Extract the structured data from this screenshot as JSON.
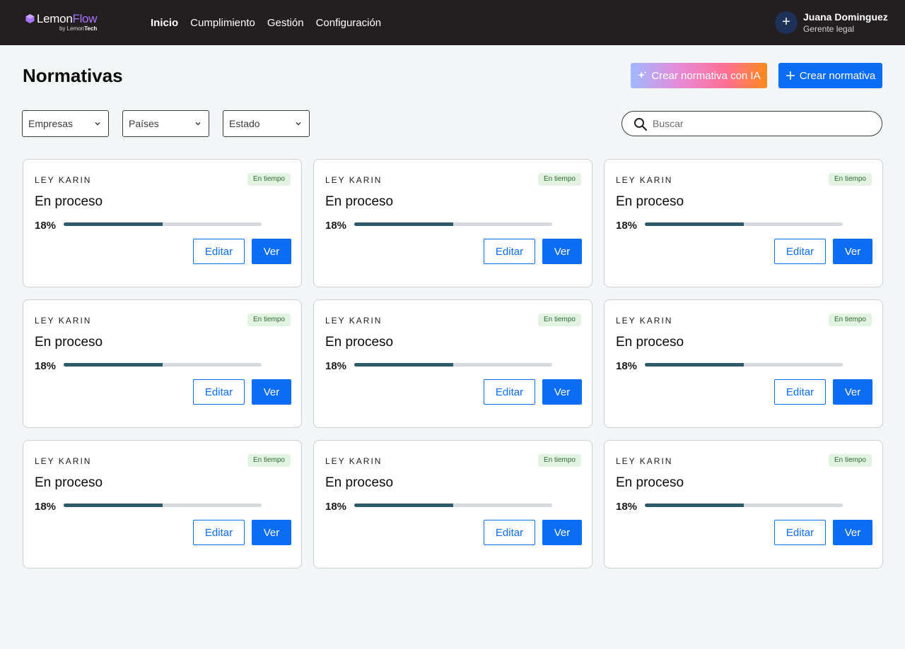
{
  "brand": {
    "name_part1": "Lemon",
    "name_part2": "Flow",
    "sub_prefix": "by ",
    "sub_part1": "Lemon",
    "sub_part2": "Tech"
  },
  "nav": {
    "items": [
      {
        "label": "Inicio",
        "active": true
      },
      {
        "label": "Cumplimiento",
        "active": false
      },
      {
        "label": "Gestión",
        "active": false
      },
      {
        "label": "Configuración",
        "active": false
      }
    ]
  },
  "user": {
    "avatar_glyph": "+",
    "name": "Juana Dominguez",
    "role": "Gerente legal"
  },
  "page": {
    "title": "Normativas"
  },
  "actions": {
    "ai_create_label": "Crear normativa con IA",
    "create_label": "Crear normativa"
  },
  "filters": {
    "companies": "Empresas",
    "countries": "Países",
    "status": "Estado"
  },
  "search": {
    "placeholder": "Buscar",
    "value": ""
  },
  "colors": {
    "primary": "#0b6cf5",
    "topbar": "#231f20",
    "progress": "#2c5a6b",
    "badge_bg": "#e3f3e2",
    "badge_text": "#2f6a35",
    "brand_accent": "#a974ff"
  },
  "cards": [
    {
      "kicker": "LEY KARIN",
      "badge": "En tiempo",
      "status": "En proceso",
      "progress_label": "18%",
      "progress": 0.5,
      "edit_label": "Editar",
      "view_label": "Ver"
    },
    {
      "kicker": "LEY KARIN",
      "badge": "En tiempo",
      "status": "En proceso",
      "progress_label": "18%",
      "progress": 0.5,
      "edit_label": "Editar",
      "view_label": "Ver"
    },
    {
      "kicker": "LEY KARIN",
      "badge": "En tiempo",
      "status": "En proceso",
      "progress_label": "18%",
      "progress": 0.5,
      "edit_label": "Editar",
      "view_label": "Ver"
    },
    {
      "kicker": "LEY KARIN",
      "badge": "En tiempo",
      "status": "En proceso",
      "progress_label": "18%",
      "progress": 0.5,
      "edit_label": "Editar",
      "view_label": "Ver"
    },
    {
      "kicker": "LEY KARIN",
      "badge": "En tiempo",
      "status": "En proceso",
      "progress_label": "18%",
      "progress": 0.5,
      "edit_label": "Editar",
      "view_label": "Ver"
    },
    {
      "kicker": "LEY KARIN",
      "badge": "En tiempo",
      "status": "En proceso",
      "progress_label": "18%",
      "progress": 0.5,
      "edit_label": "Editar",
      "view_label": "Ver"
    },
    {
      "kicker": "LEY KARIN",
      "badge": "En tiempo",
      "status": "En proceso",
      "progress_label": "18%",
      "progress": 0.5,
      "edit_label": "Editar",
      "view_label": "Ver"
    },
    {
      "kicker": "LEY KARIN",
      "badge": "En tiempo",
      "status": "En proceso",
      "progress_label": "18%",
      "progress": 0.5,
      "edit_label": "Editar",
      "view_label": "Ver"
    },
    {
      "kicker": "LEY KARIN",
      "badge": "En tiempo",
      "status": "En proceso",
      "progress_label": "18%",
      "progress": 0.5,
      "edit_label": "Editar",
      "view_label": "Ver"
    }
  ]
}
